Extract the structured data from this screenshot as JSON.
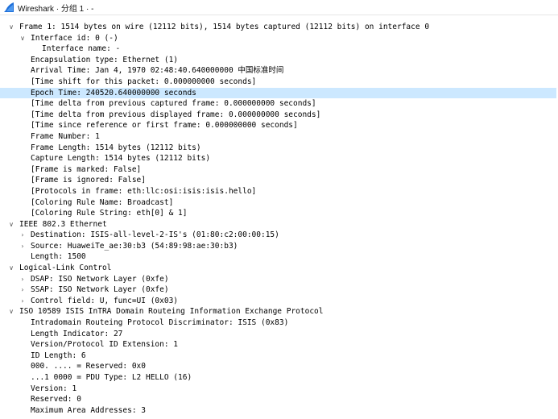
{
  "window": {
    "title": "Wireshark · 分组 1 · -"
  },
  "tree": [
    {
      "label": "Frame 1: 1514 bytes on wire (12112 bits), 1514 bytes captured (12112 bits) on interface 0",
      "level": 0,
      "state": "expanded"
    },
    {
      "label": "Interface id: 0 (-)",
      "level": 1,
      "state": "expanded"
    },
    {
      "label": "Interface name: -",
      "level": 2,
      "state": "leaf"
    },
    {
      "label": "Encapsulation type: Ethernet (1)",
      "level": 1,
      "state": "leaf"
    },
    {
      "label": "Arrival Time: Jan  4, 1970 02:48:40.640000000 中国标准时间",
      "level": 1,
      "state": "leaf"
    },
    {
      "label": "[Time shift for this packet: 0.000000000 seconds]",
      "level": 1,
      "state": "leaf"
    },
    {
      "label": "Epoch Time: 240520.640000000 seconds",
      "level": 1,
      "state": "leaf",
      "selected": true
    },
    {
      "label": "[Time delta from previous captured frame: 0.000000000 seconds]",
      "level": 1,
      "state": "leaf"
    },
    {
      "label": "[Time delta from previous displayed frame: 0.000000000 seconds]",
      "level": 1,
      "state": "leaf"
    },
    {
      "label": "[Time since reference or first frame: 0.000000000 seconds]",
      "level": 1,
      "state": "leaf"
    },
    {
      "label": "Frame Number: 1",
      "level": 1,
      "state": "leaf"
    },
    {
      "label": "Frame Length: 1514 bytes (12112 bits)",
      "level": 1,
      "state": "leaf"
    },
    {
      "label": "Capture Length: 1514 bytes (12112 bits)",
      "level": 1,
      "state": "leaf"
    },
    {
      "label": "[Frame is marked: False]",
      "level": 1,
      "state": "leaf"
    },
    {
      "label": "[Frame is ignored: False]",
      "level": 1,
      "state": "leaf"
    },
    {
      "label": "[Protocols in frame: eth:llc:osi:isis:isis.hello]",
      "level": 1,
      "state": "leaf"
    },
    {
      "label": "[Coloring Rule Name: Broadcast]",
      "level": 1,
      "state": "leaf"
    },
    {
      "label": "[Coloring Rule String: eth[0] & 1]",
      "level": 1,
      "state": "leaf"
    },
    {
      "label": "IEEE 802.3 Ethernet",
      "level": 0,
      "state": "expanded"
    },
    {
      "label": "Destination: ISIS-all-level-2-IS's (01:80:c2:00:00:15)",
      "level": 1,
      "state": "collapsed"
    },
    {
      "label": "Source: HuaweiTe_ae:30:b3 (54:89:98:ae:30:b3)",
      "level": 1,
      "state": "collapsed"
    },
    {
      "label": "Length: 1500",
      "level": 1,
      "state": "leaf"
    },
    {
      "label": "Logical-Link Control",
      "level": 0,
      "state": "expanded"
    },
    {
      "label": "DSAP: ISO Network Layer (0xfe)",
      "level": 1,
      "state": "collapsed"
    },
    {
      "label": "SSAP: ISO Network Layer (0xfe)",
      "level": 1,
      "state": "collapsed"
    },
    {
      "label": "Control field: U, func=UI (0x03)",
      "level": 1,
      "state": "collapsed"
    },
    {
      "label": "ISO 10589 ISIS InTRA Domain Routeing Information Exchange Protocol",
      "level": 0,
      "state": "expanded"
    },
    {
      "label": "Intradomain Routeing Protocol Discriminator: ISIS (0x83)",
      "level": 1,
      "state": "leaf"
    },
    {
      "label": "Length Indicator: 27",
      "level": 1,
      "state": "leaf"
    },
    {
      "label": "Version/Protocol ID Extension: 1",
      "level": 1,
      "state": "leaf"
    },
    {
      "label": "ID Length: 6",
      "level": 1,
      "state": "leaf"
    },
    {
      "label": "000. .... = Reserved: 0x0",
      "level": 1,
      "state": "leaf"
    },
    {
      "label": "...1 0000 = PDU Type: L2 HELLO (16)",
      "level": 1,
      "state": "leaf"
    },
    {
      "label": "Version: 1",
      "level": 1,
      "state": "leaf"
    },
    {
      "label": "Reserved: 0",
      "level": 1,
      "state": "leaf"
    },
    {
      "label": "Maximum Area Addresses: 3",
      "level": 1,
      "state": "leaf"
    }
  ],
  "colors": {
    "selection": "#cce8ff",
    "app_icon": "#1e6fd9"
  }
}
